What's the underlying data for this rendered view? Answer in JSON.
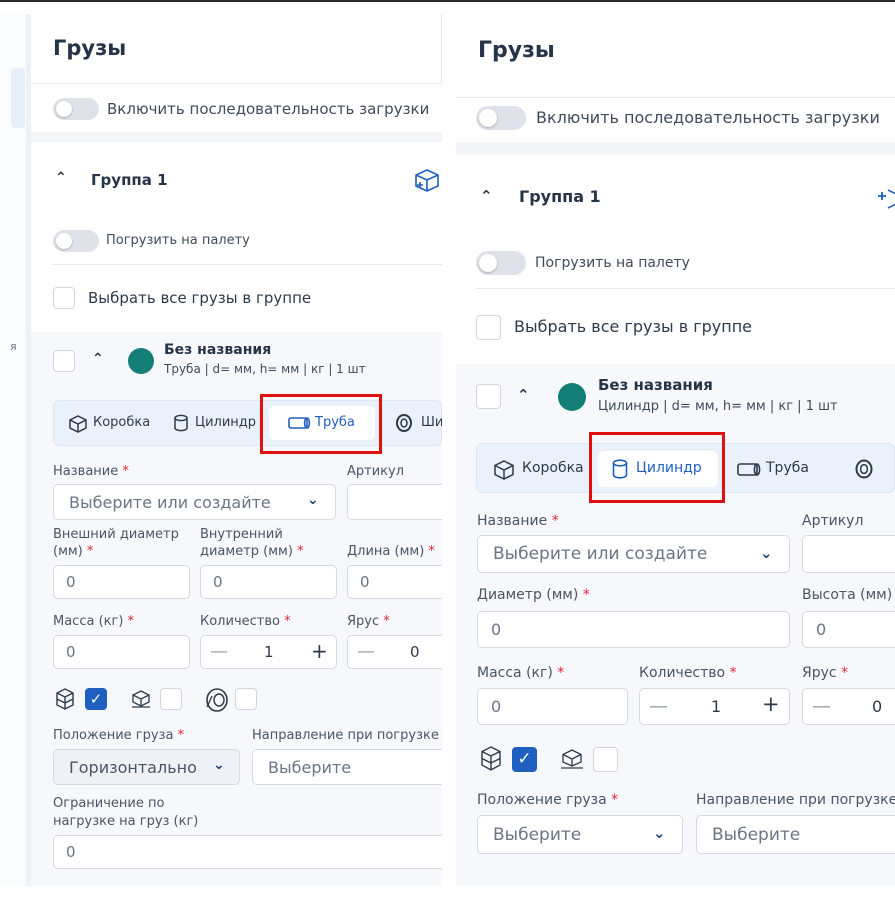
{
  "left": {
    "title": "Грузы",
    "toggle_seq": "Включить последовательность загрузки",
    "group": {
      "label": "Группа 1",
      "toggle_pallet": "Погрузить на палету",
      "select_all": "Выбрать все грузы в группе"
    },
    "item": {
      "title": "Без названия",
      "subtitle": "Труба | d= мм, h= мм | кг | 1 шт"
    },
    "tabs": {
      "box": "Коробка",
      "cylinder": "Цилиндр",
      "pipe": "Труба",
      "tire_partial": "Ши"
    },
    "fields": {
      "name_label": "Название",
      "name_placeholder": "Выберите или создайте",
      "article_label": "Артикул",
      "outer_diameter_label_1": "Внешний диаметр",
      "outer_diameter_label_2": "(мм)",
      "inner_diameter_label_1": "Внутренний",
      "inner_diameter_label_2": "диаметр (мм)",
      "length_label": "Длина (мм)",
      "outer_value": "0",
      "inner_value": "0",
      "length_value": "0",
      "mass_label": "Масса (кг)",
      "mass_value": "0",
      "qty_label": "Количество",
      "qty_value": "1",
      "tier_label": "Ярус",
      "tier_value": "0",
      "position_label": "Положение груза",
      "position_value": "Горизонтально",
      "direction_label": "Направление при погрузке",
      "direction_placeholder": "Выберите",
      "load_limit_label_1": "Ограничение по",
      "load_limit_label_2": "нагрузке на груз (кг)",
      "load_limit_value": "0"
    },
    "strip_char": "я"
  },
  "right": {
    "title": "Грузы",
    "toggle_seq": "Включить последовательность загрузки",
    "group": {
      "label": "Группа 1",
      "toggle_pallet": "Погрузить на палету",
      "select_all": "Выбрать все грузы в группе"
    },
    "item": {
      "title": "Без названия",
      "subtitle": "Цилиндр | d= мм, h= мм | кг | 1 шт"
    },
    "tabs": {
      "box": "Коробка",
      "cylinder": "Цилиндр",
      "pipe": "Труба"
    },
    "fields": {
      "name_label": "Название",
      "name_placeholder": "Выберите или создайте",
      "article_label": "Артикул",
      "diameter_label": "Диаметр (мм)",
      "diameter_value": "0",
      "height_label": "Высота (мм)",
      "height_value": "0",
      "mass_label": "Масса (кг)",
      "mass_value": "0",
      "qty_label": "Количество",
      "qty_value": "1",
      "tier_label": "Ярус",
      "tier_value": "0",
      "position_label": "Положение груза",
      "position_placeholder": "Выберите",
      "direction_label": "Направление при погрузке",
      "direction_placeholder": "Выберите"
    }
  },
  "colors": {
    "accent": "#1f5fbf",
    "item_dot": "#137f76",
    "highlight": "#e01010",
    "required": "#e0243a"
  }
}
